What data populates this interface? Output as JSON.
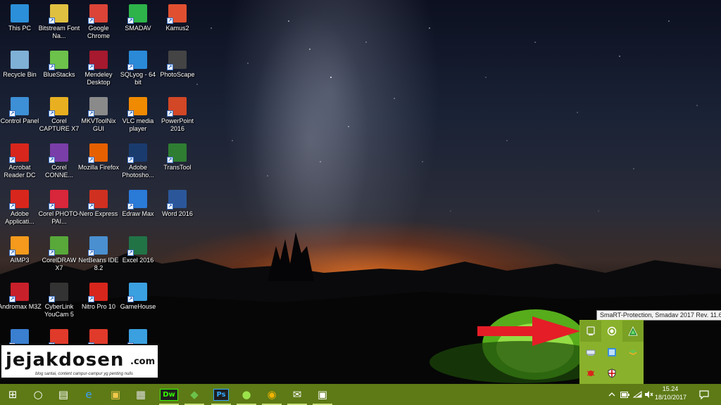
{
  "desktop": {
    "icons": [
      {
        "label": "This PC",
        "icon": "this-pc-icon",
        "color": "#2b8fd9"
      },
      {
        "label": "Recycle Bin",
        "icon": "recycle-bin-icon",
        "color": "#7fb0d6"
      },
      {
        "label": "Control Panel",
        "icon": "control-panel-icon",
        "color": "#3d8fd6"
      },
      {
        "label": "Acrobat Reader DC",
        "icon": "acrobat-reader-icon",
        "color": "#d8261c"
      },
      {
        "label": "Adobe Applicati...",
        "icon": "adobe-application-manager-icon",
        "color": "#d8261c"
      },
      {
        "label": "AIMP3",
        "icon": "aimp-icon",
        "color": "#f59a1c"
      },
      {
        "label": "Andromax M3Z",
        "icon": "andromax-icon",
        "color": "#c8202a"
      },
      {
        "label": "",
        "icon": "globe-shortcut-icon",
        "color": "#3a7fd0"
      },
      {
        "label": "Bitstream Font Na...",
        "icon": "bitstream-font-icon",
        "color": "#e0c040"
      },
      {
        "label": "BlueStacks",
        "icon": "bluestacks-icon",
        "color": "#6cc24a"
      },
      {
        "label": "Corel CAPTURE X7",
        "icon": "corel-capture-icon",
        "color": "#e8b020"
      },
      {
        "label": "Corel CONNE...",
        "icon": "corel-connect-icon",
        "color": "#7a3ea8"
      },
      {
        "label": "Corel PHOTO-PAI...",
        "icon": "corel-photo-paint-icon",
        "color": "#d8263a"
      },
      {
        "label": "CorelDRAW X7",
        "icon": "coreldraw-icon",
        "color": "#58a83a"
      },
      {
        "label": "CyberLink YouCam 5",
        "icon": "youcam-icon",
        "color": "#333333"
      },
      {
        "label": "",
        "icon": "shortcut-red-icon",
        "color": "#e03a2a"
      },
      {
        "label": "Google Chrome",
        "icon": "chrome-icon",
        "color": "#db4437"
      },
      {
        "label": "Mendeley Desktop",
        "icon": "mendeley-icon",
        "color": "#a6192e"
      },
      {
        "label": "MKVToolNix GUI",
        "icon": "mkvtoolnix-icon",
        "color": "#8a8a8a"
      },
      {
        "label": "Mozilla Firefox",
        "icon": "firefox-icon",
        "color": "#e66000"
      },
      {
        "label": "Nero Express",
        "icon": "nero-icon",
        "color": "#d03020"
      },
      {
        "label": "NetBeans IDE 8.2",
        "icon": "netbeans-icon",
        "color": "#4a8fd0"
      },
      {
        "label": "Nitro Pro 10",
        "icon": "nitro-icon",
        "color": "#d8261c"
      },
      {
        "label": "",
        "icon": "shortcut-red2-icon",
        "color": "#e03a2a"
      },
      {
        "label": "SMADAV",
        "icon": "smadav-icon",
        "color": "#2db34a"
      },
      {
        "label": "SQLyog - 64 bit",
        "icon": "sqlyog-icon",
        "color": "#2a8ad8"
      },
      {
        "label": "VLC media player",
        "icon": "vlc-icon",
        "color": "#f08a00"
      },
      {
        "label": "Adobe Photosho...",
        "icon": "photoshop-icon",
        "color": "#1a3b6e"
      },
      {
        "label": "Edraw Max",
        "icon": "edraw-icon",
        "color": "#2a7ad8"
      },
      {
        "label": "Excel 2016",
        "icon": "excel-icon",
        "color": "#217346"
      },
      {
        "label": "GameHouse",
        "icon": "gamehouse-icon",
        "color": "#3aa0e0"
      },
      {
        "label": "",
        "icon": "internet-shortcut-icon",
        "color": "#3aa0e0"
      },
      {
        "label": "Kamus2",
        "icon": "kamus-icon",
        "color": "#e05030"
      },
      {
        "label": "PhotoScape",
        "icon": "photoscape-icon",
        "color": "#444444"
      },
      {
        "label": "PowerPoint 2016",
        "icon": "powerpoint-icon",
        "color": "#d24726"
      },
      {
        "label": "TransTool",
        "icon": "transtool-icon",
        "color": "#2e7d32"
      },
      {
        "label": "Word 2016",
        "icon": "word-icon",
        "color": "#2b579a"
      }
    ]
  },
  "watermark": {
    "brand": "jejakdosen",
    "domain": ".com",
    "tagline": "blog santai, content campur-campur yg penting nulis"
  },
  "tooltip": {
    "text": "SmaRT-Protection, Smadav 2017 Rev. 11.6"
  },
  "tray_popup": {
    "items": [
      {
        "icon": "tablet-mode-icon"
      },
      {
        "icon": "record-icon"
      },
      {
        "icon": "smadav-tray-icon"
      },
      {
        "icon": "network-drive-icon"
      },
      {
        "icon": "windows-app-icon"
      },
      {
        "icon": "bluestacks-tray-icon"
      },
      {
        "icon": "bug-icon"
      },
      {
        "icon": "shield-tray-icon"
      }
    ]
  },
  "taskbar": {
    "pinned": [
      {
        "icon": "start-icon"
      },
      {
        "icon": "cortana-icon"
      },
      {
        "icon": "task-view-icon"
      },
      {
        "icon": "edge-icon"
      },
      {
        "icon": "file-explorer-icon"
      },
      {
        "icon": "store-icon"
      },
      {
        "icon": "dreamweaver-icon",
        "text": "Dw"
      },
      {
        "icon": "bluestacks-taskbar-icon"
      },
      {
        "icon": "photoshop-taskbar-icon",
        "text": "Ps"
      },
      {
        "icon": "android-icon"
      },
      {
        "icon": "chrome-taskbar-icon"
      },
      {
        "icon": "mail-icon"
      },
      {
        "icon": "app-taskbar-icon"
      }
    ],
    "clock_time": "15.24",
    "clock_date": "18/10/2017"
  }
}
